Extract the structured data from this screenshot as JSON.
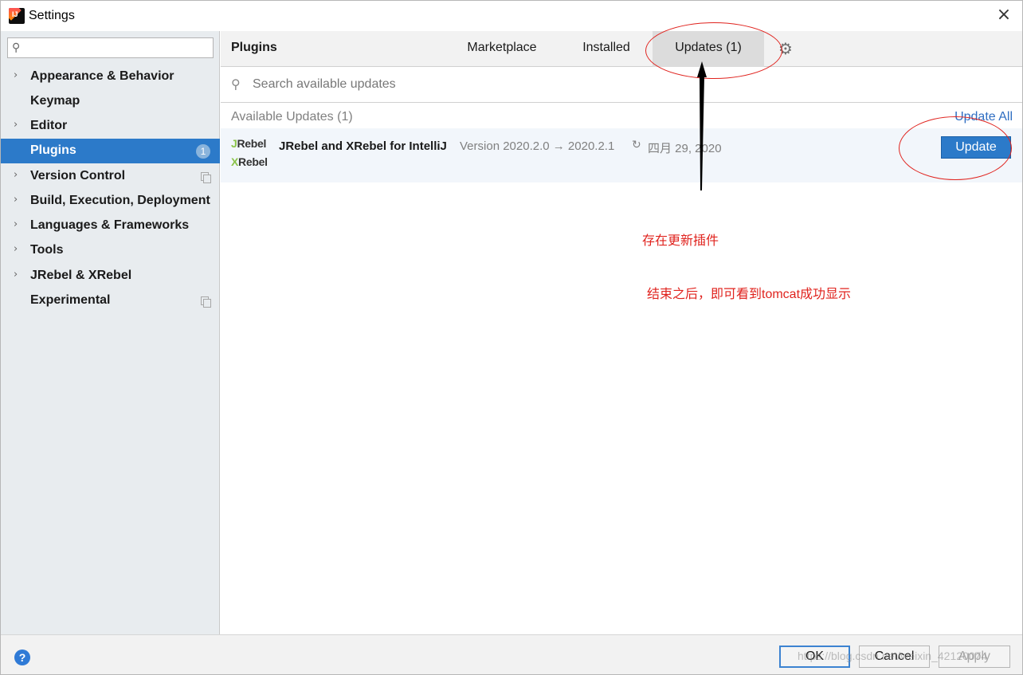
{
  "window": {
    "title": "Settings",
    "close_glyph": "×"
  },
  "sidebar": {
    "search_placeholder": "",
    "search_icon": "search-icon",
    "items": [
      {
        "label": "Appearance & Behavior",
        "expandable": true
      },
      {
        "label": "Keymap",
        "expandable": false
      },
      {
        "label": "Editor",
        "expandable": true
      },
      {
        "label": "Plugins",
        "expandable": false,
        "selected": true,
        "badge": "1"
      },
      {
        "label": "Version Control",
        "expandable": true,
        "copy_icon": true
      },
      {
        "label": "Build, Execution, Deployment",
        "expandable": true
      },
      {
        "label": "Languages & Frameworks",
        "expandable": true
      },
      {
        "label": "Tools",
        "expandable": true
      },
      {
        "label": "JRebel & XRebel",
        "expandable": true
      },
      {
        "label": "Experimental",
        "expandable": false,
        "copy_icon": true
      }
    ]
  },
  "plugins": {
    "title": "Plugins",
    "tabs": [
      {
        "label": "Marketplace"
      },
      {
        "label": "Installed"
      },
      {
        "label": "Updates (1)",
        "active": true
      }
    ],
    "search_placeholder": "Search available updates",
    "available_header": "Available Updates (1)",
    "update_all_label": "Update All",
    "plugin": {
      "logo_j_first": "J",
      "logo_j_rest": "Rebel",
      "logo_x_first": "X",
      "logo_x_rest": "Rebel",
      "name": "JRebel and XRebel for IntelliJ",
      "version": "Version 2020.2.0 → 2020.2.1",
      "date": "四月 29, 2020",
      "update_label": "Update"
    }
  },
  "annotations": {
    "note1": "存在更新插件",
    "note2": "结束之后，即可看到tomcat成功显示",
    "color": "#e0231e"
  },
  "footer": {
    "help_label": "?",
    "ok_label": "OK",
    "cancel_label": "Cancel",
    "apply_label": "Apply",
    "watermark": "https://blog.csdn.net/weixin_42120074"
  },
  "colors": {
    "accent": "#2c7ac9",
    "sidebar_bg": "#e8ecef",
    "link": "#2f6ec2",
    "jrebel_green": "#8bc34a"
  }
}
